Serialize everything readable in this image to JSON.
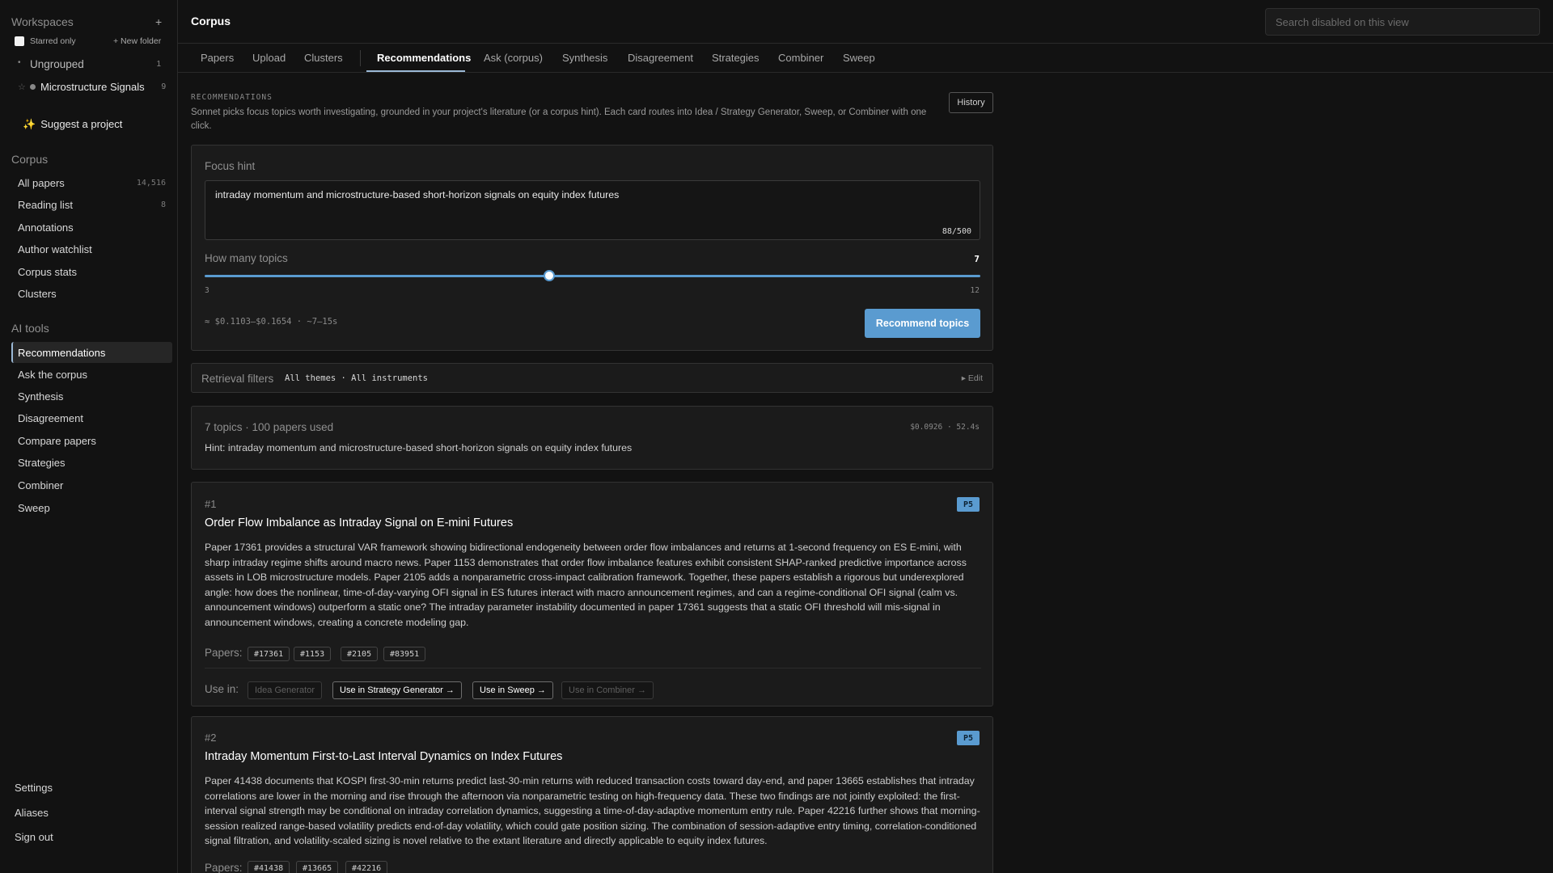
{
  "sidebar": {
    "workspaces_title": "Workspaces",
    "add_icon": "+",
    "starred_only_label": "Starred only",
    "new_folder_label": "+ New folder",
    "folders": [
      {
        "label": "Ungrouped",
        "count": "1"
      },
      {
        "label": "Microstructure Signals",
        "count": "9"
      }
    ],
    "suggest_label": "Suggest a project",
    "corpus_title": "Corpus",
    "corpus_items": [
      {
        "label": "All papers",
        "count": "14,516"
      },
      {
        "label": "Reading list",
        "count": "8"
      },
      {
        "label": "Annotations",
        "count": ""
      },
      {
        "label": "Author watchlist",
        "count": ""
      },
      {
        "label": "Corpus stats",
        "count": ""
      },
      {
        "label": "Clusters",
        "count": ""
      }
    ],
    "ai_title": "AI tools",
    "ai_items": [
      {
        "label": "Recommendations"
      },
      {
        "label": "Ask the corpus"
      },
      {
        "label": "Synthesis"
      },
      {
        "label": "Disagreement"
      },
      {
        "label": "Compare papers"
      },
      {
        "label": "Strategies"
      },
      {
        "label": "Combiner"
      },
      {
        "label": "Sweep"
      }
    ],
    "bottom": [
      "Settings",
      "Aliases",
      "Sign out"
    ]
  },
  "header": {
    "title": "Corpus",
    "search_placeholder": "Search disabled on this view"
  },
  "tabs": [
    "Papers",
    "Upload",
    "Clusters",
    "Recommendations",
    "Ask (corpus)",
    "Synthesis",
    "Disagreement",
    "Strategies",
    "Combiner",
    "Sweep"
  ],
  "intro": {
    "eyebrow": "RECOMMENDATIONS",
    "description": "Sonnet picks focus topics worth investigating, grounded in your project's literature (or a corpus hint). Each card routes into Idea / Strategy Generator, Sweep, or Combiner with one click.",
    "history_label": "History"
  },
  "form": {
    "focus_label": "Focus hint",
    "focus_value": "intraday momentum and microstructure-based short-horizon signals on equity index futures",
    "char_count": "88/500",
    "topics_label": "How many topics",
    "topics_value": "7",
    "slider_min": "3",
    "slider_max": "12",
    "slider_fraction": 0.444,
    "estimate": "≈ $0.1103–$0.1654 · ~7–15s",
    "recommend_label": "Recommend topics"
  },
  "filters": {
    "label": "Retrieval filters",
    "value": "All themes · All instruments",
    "edit_label": "▸ Edit"
  },
  "summary": {
    "headline": "7 topics · 100 papers used",
    "meta": "$0.0926 · 52.4s",
    "hint": "Hint: intraday momentum and microstructure-based short-horizon signals on equity index futures"
  },
  "topics": [
    {
      "rank": "#1",
      "badge": "P5",
      "title": "Order Flow Imbalance as Intraday Signal on E-mini Futures",
      "body": "Paper 17361 provides a structural VAR framework showing bidirectional endogeneity between order flow imbalances and returns at 1-second frequency on ES E-mini, with sharp intraday regime shifts around macro news. Paper 1153 demonstrates that order flow imbalance features exhibit consistent SHAP-ranked predictive importance across assets in LOB microstructure models. Paper 2105 adds a nonparametric cross-impact calibration framework. Together, these papers establish a rigorous but underexplored angle: how does the nonlinear, time-of-day-varying OFI signal in ES futures interact with macro announcement regimes, and can a regime-conditional OFI signal (calm vs. announcement windows) outperform a static one? The intraday parameter instability documented in paper 17361 suggests that a static OFI threshold will mis-signal in announcement windows, creating a concrete modeling gap.",
      "papers_label": "Papers:",
      "papers": [
        "#17361",
        "#1153",
        "#2105",
        "#83951"
      ],
      "use_in_label": "Use in:",
      "actions": [
        "Idea Generator",
        "Use in Strategy Generator →",
        "Use in Sweep →",
        "Use in Combiner →"
      ]
    },
    {
      "rank": "#2",
      "badge": "P5",
      "title": "Intraday Momentum First-to-Last Interval Dynamics on Index Futures",
      "body": "Paper 41438 documents that KOSPI first-30-min returns predict last-30-min returns with reduced transaction costs toward day-end, and paper 13665 establishes that intraday correlations are lower in the morning and rise through the afternoon via nonparametric testing on high-frequency data. These two findings are not jointly exploited: the first-interval signal strength may be conditional on intraday correlation dynamics, suggesting a time-of-day-adaptive momentum entry rule. Paper 42216 further shows that morning-session realized range-based volatility predicts end-of-day volatility, which could gate position sizing. The combination of session-adaptive entry timing, correlation-conditioned signal filtration, and volatility-scaled sizing is novel relative to the extant literature and directly applicable to equity index futures.",
      "papers_label": "Papers:",
      "papers": [
        "#41438",
        "#13665",
        "#42216"
      ]
    }
  ],
  "colors": {
    "accent": "#9bb9d6",
    "primary_button": "#5a9bd0",
    "background": "#121212",
    "card": "#1b1b1b"
  }
}
